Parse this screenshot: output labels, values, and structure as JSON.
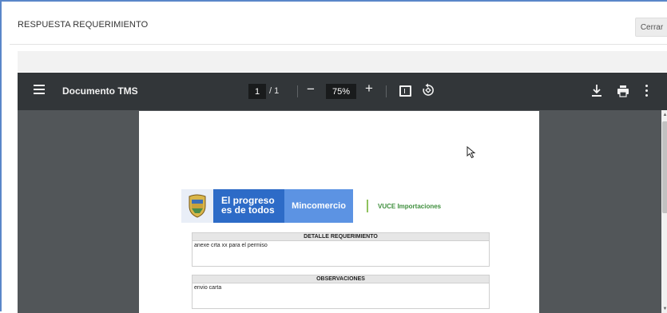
{
  "dialog": {
    "title": "RESPUESTA REQUERIMIENTO",
    "close_label": "Cerrar"
  },
  "viewer": {
    "document_title": "Documento TMS",
    "current_page": "1",
    "page_separator": "/",
    "total_pages": "1",
    "zoom_value": "75%",
    "zoom_minus": "−",
    "zoom_plus": "+"
  },
  "pdf": {
    "banner_line1": "El progreso",
    "banner_line2": "es de todos",
    "banner_brand": "Mincomercio",
    "vuce_label": "VUCE Importaciones",
    "sections": [
      {
        "header": "DETALLE REQUERIMIENTO",
        "content": "anexe crta xx para el permiso"
      },
      {
        "header": "OBSERVACIONES",
        "content": "envio carta"
      }
    ]
  },
  "scrollbar": {
    "up": "▲",
    "down": "▼"
  },
  "colors": {
    "toolbar": "#323639",
    "viewer_bg": "#525659",
    "banner_blue": "#2d6bc7",
    "banner_light": "#5c93e3",
    "vuce_green": "#3f8f3d"
  }
}
